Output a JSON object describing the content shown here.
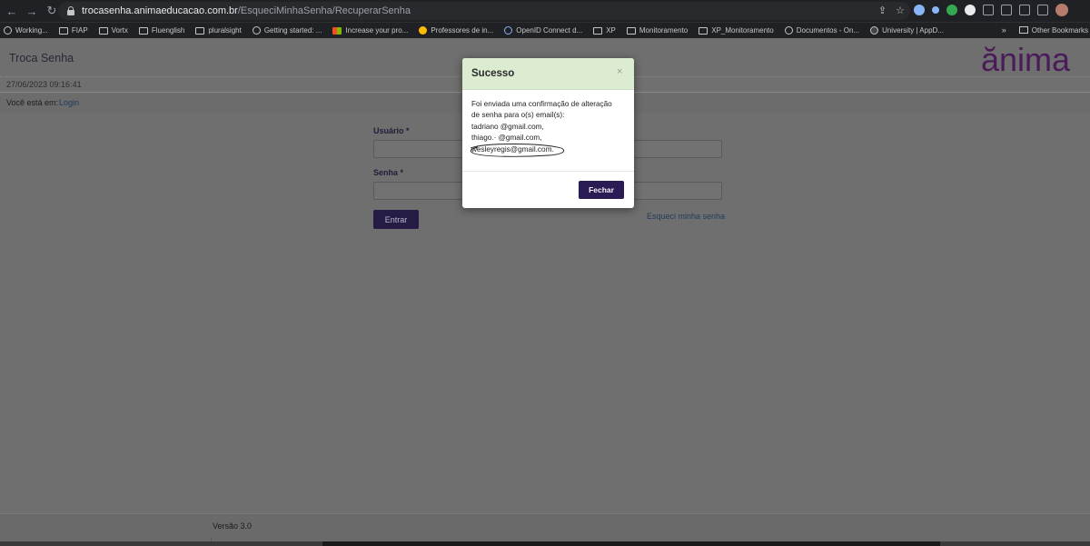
{
  "browser": {
    "url_host": "trocasenha.animaeducacao.com.br",
    "url_path": "/EsqueciMinhaSenha/RecuperarSenha",
    "bookmarks": [
      "Working...",
      "FIAP",
      "Vortx",
      "Fluenglish",
      "pluralsight",
      "Getting started: ...",
      "Increase your pro...",
      "Professores de in...",
      "OpenID Connect d...",
      "XP",
      "Monitoramento",
      "XP_Monitoramento",
      "Documentos - On...",
      "University | AppD..."
    ],
    "other_bookmarks": "Other Bookmarks"
  },
  "page": {
    "app_title": "Troca Senha",
    "logo_text": "ănima",
    "datetime": "27/06/2023 09:16:41",
    "breadcrumb_label": "Você está em:",
    "breadcrumb_link": "Login",
    "usuario_label": "Usuário *",
    "senha_label": "Senha *",
    "entrar_label": "Entrar",
    "forgot_label": "Esqueci minha senha",
    "version": "Versão 3.0"
  },
  "modal": {
    "title": "Sucesso",
    "close": "×",
    "lines": [
      "Foi enviada uma confirmação de alteração",
      "de senha para o(s) email(s):",
      "tadriano        @gmail.com,",
      "thiago.·            @gmail.com,",
      "wesleyregis@gmail.com."
    ],
    "button": "Fechar"
  },
  "colors": {
    "brand": "#5a1f6b",
    "modal_header": "#dbecd1",
    "primary_button": "#2a1b55"
  }
}
